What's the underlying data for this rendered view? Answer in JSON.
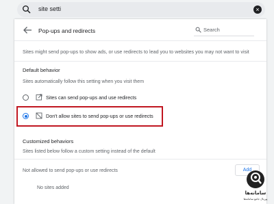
{
  "search": {
    "value": "site setti",
    "clear_icon": "×"
  },
  "header": {
    "title": "Pop-ups and redirects",
    "search_placeholder": "Search"
  },
  "description": "Sites might send pop-ups to show ads, or use redirects to lead you to websites you may not want to visit",
  "default_behavior": {
    "heading": "Default behavior",
    "subtext": "Sites automatically follow this setting when you visit them",
    "options": [
      {
        "label": "Sites can send pop-ups and use redirects",
        "selected": false,
        "icon": "open-in-new-icon"
      },
      {
        "label": "Don't allow sites to send pop-ups or use redirects",
        "selected": true,
        "icon": "block-popup-icon"
      }
    ]
  },
  "customized": {
    "heading": "Customized behaviors",
    "subtext": "Sites listed below follow a custom setting instead of the default",
    "not_allowed_label": "Not allowed to send pop-ups or use redirects",
    "add_button": "Add",
    "empty_text": "No sites added"
  },
  "watermark": {
    "title": "سامانه‌ها",
    "subtitle": "پورتال جامع سامانه‌ها"
  },
  "colors": {
    "accent": "#1a73e8",
    "highlight": "#c0151f"
  }
}
